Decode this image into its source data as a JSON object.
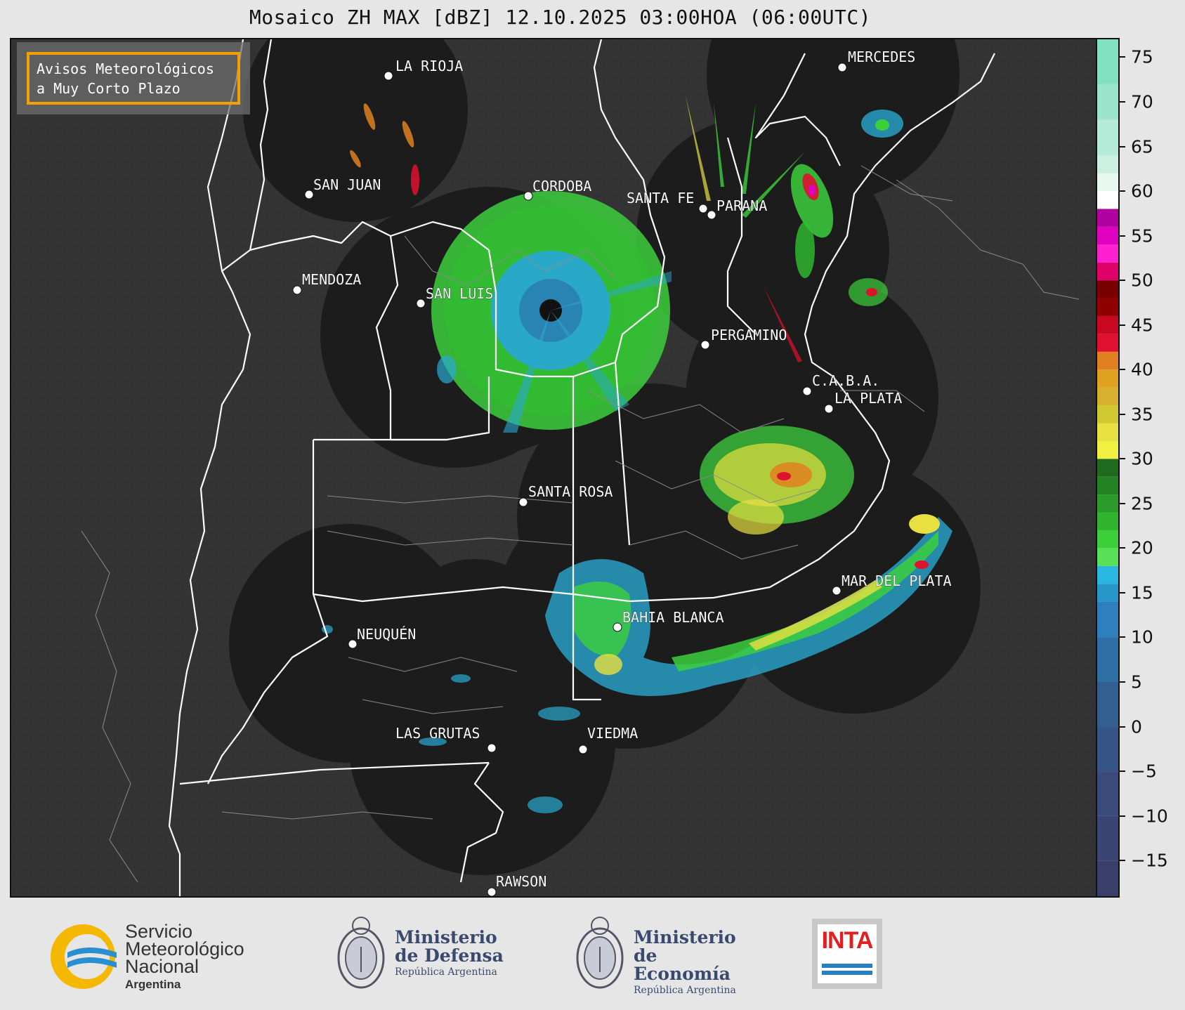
{
  "title": "Mosaico ZH MAX [dBZ] 12.10.2025 03:00HOA (06:00UTC)",
  "notice": {
    "line1": "Avisos Meteorológicos",
    "line2": "a Muy Corto Plazo",
    "border_color": "#f2a000"
  },
  "cities": [
    {
      "name": "LA RIOJA"
    },
    {
      "name": "SAN JUAN"
    },
    {
      "name": "CORDOBA"
    },
    {
      "name": "SANTA FE"
    },
    {
      "name": "PARANA"
    },
    {
      "name": "MERCEDES"
    },
    {
      "name": "MENDOZA"
    },
    {
      "name": "SAN LUIS"
    },
    {
      "name": "PERGAMINO"
    },
    {
      "name": "C.A.B.A."
    },
    {
      "name": "LA PLATA"
    },
    {
      "name": "SANTA ROSA"
    },
    {
      "name": "MAR DEL PLATA"
    },
    {
      "name": "BAHIA BLANCA"
    },
    {
      "name": "NEUQUÉN"
    },
    {
      "name": "LAS GRUTAS"
    },
    {
      "name": "VIEDMA"
    },
    {
      "name": "RAWSON"
    }
  ],
  "colorbar": {
    "unit": "dBZ",
    "range": [
      -19,
      77
    ],
    "ticks": [
      "75",
      "70",
      "65",
      "60",
      "55",
      "50",
      "45",
      "40",
      "35",
      "30",
      "25",
      "20",
      "15",
      "10",
      "5",
      "0",
      "−5",
      "−10",
      "−15"
    ],
    "colors": {
      "low": "#3a4a7a",
      "blue": "#2f7fbf",
      "cyan": "#29b6e0",
      "green": "#3ccf3c",
      "darkgreen": "#1f6a1f",
      "yellow": "#e8e040",
      "orange": "#e08020",
      "red": "#e01030",
      "darkred": "#900000",
      "magenta": "#e000c0",
      "white": "#ffffff",
      "mint": "#80e0c0"
    }
  },
  "footer": {
    "smn_line1": "Servicio",
    "smn_line2": "Meteorológico",
    "smn_line3": "Nacional",
    "smn_sub": "Argentina",
    "defensa_line1": "Ministerio",
    "defensa_line2": "de Defensa",
    "defensa_sub": "República Argentina",
    "economia_line1": "Ministerio",
    "economia_line2": "de Economía",
    "economia_sub": "República Argentina",
    "inta": "INTA"
  }
}
